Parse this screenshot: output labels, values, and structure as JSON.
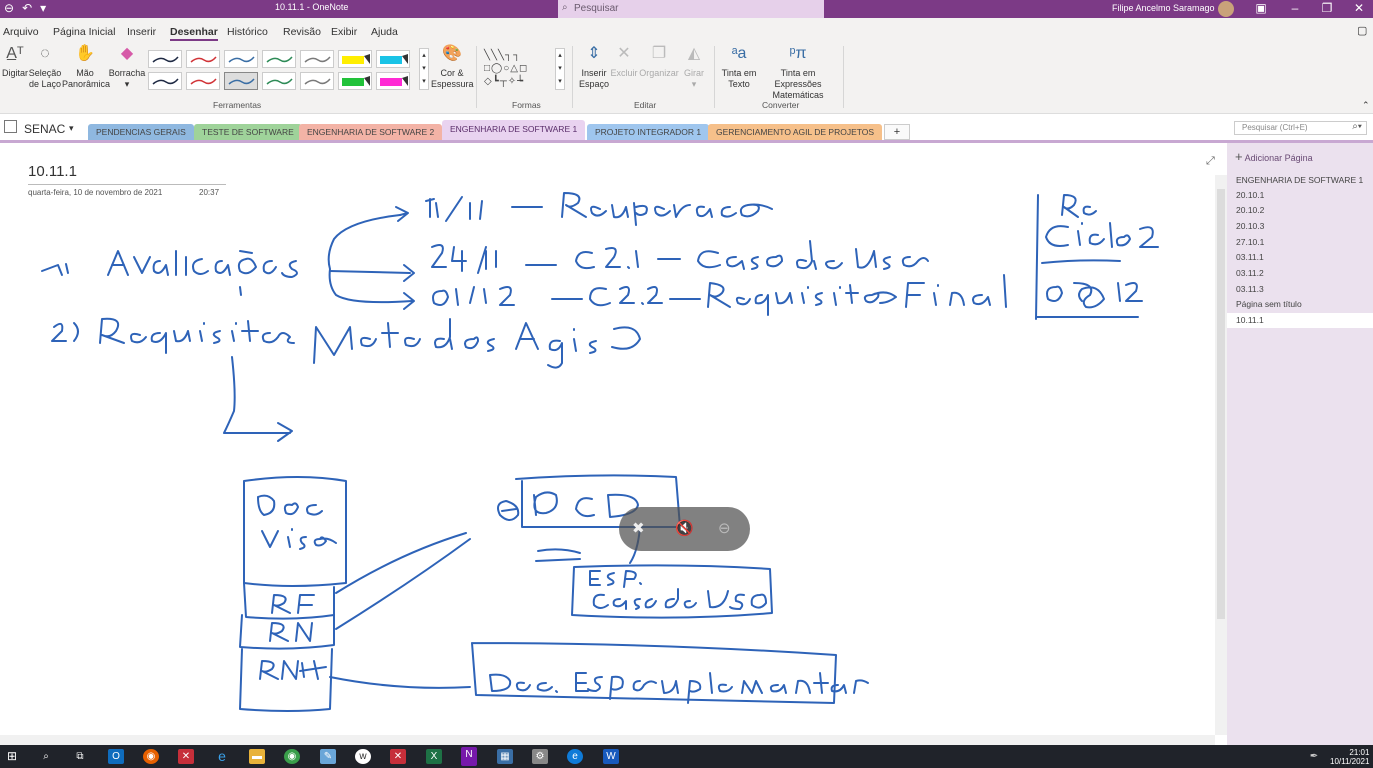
{
  "titlebar": {
    "title": "10.11.1 - OneNote",
    "search_placeholder": "Pesquisar",
    "user": "Filipe Ancelmo Saramago"
  },
  "menu": [
    "Arquivo",
    "Página Inicial",
    "Inserir",
    "Desenhar",
    "Histórico",
    "Revisão",
    "Exibir",
    "Ajuda"
  ],
  "menu_active": "Desenhar",
  "ribbon": {
    "tools": [
      "Digitar",
      "Seleção de Laço",
      "Mão Panorâmica",
      "Borracha"
    ],
    "color_thickness": "Cor & Espessura",
    "shapes_label": "Formas",
    "insert_space": "Inserir Espaço",
    "delete": "Excluir",
    "arrange": "Organizar",
    "rotate": "Girar",
    "ink_to_text": "Tinta em Texto",
    "ink_to_math": "Tinta em Expressões Matemáticas",
    "groups": {
      "tools": "Ferramentas",
      "shapes": "Formas",
      "edit": "Editar",
      "convert": "Converter"
    },
    "pen_colors": [
      "#1f2a44",
      "#d13438",
      "#3a6ea5",
      "#2e8b57",
      "#7a7a7a",
      "#ffee00",
      "#19c3e6",
      "#1f2a44",
      "#d13438",
      "#3a6ea5",
      "#2e8b57",
      "#7a7a7a",
      "#22c23a",
      "#ff2ad4"
    ]
  },
  "notebook": "SENAC",
  "tabs": [
    {
      "label": "PENDENCIAS GERAIS",
      "color": "#8fb8e0"
    },
    {
      "label": "TESTE DE SOFTWARE",
      "color": "#9fd39a"
    },
    {
      "label": "ENGENHARIA DE SOFTWARE 2",
      "color": "#f3b3a6"
    },
    {
      "label": "ENGENHARIA DE SOFTWARE 1",
      "color": "#e9d3f0"
    },
    {
      "label": "PROJETO INTEGRADOR 1",
      "color": "#9fc6ee"
    },
    {
      "label": "GERENCIAMENTO AGIL DE PROJETOS",
      "color": "#f6c08a"
    }
  ],
  "add_tab": "+",
  "page_search_placeholder": "Pesquisar (Ctrl+E)",
  "page": {
    "title": "10.11.1",
    "date": "quarta-feira, 10 de novembro de 2021",
    "time": "20:37"
  },
  "sidebar": {
    "add_page": "Adicionar Página",
    "section": "ENGENHARIA DE SOFTWARE 1",
    "pages": [
      "20.10.1",
      "20.10.2",
      "20.10.3",
      "27.10.1",
      "03.11.1",
      "03.11.2",
      "03.11.3",
      "Página sem título",
      "10.11.1"
    ],
    "current": "10.11.1"
  },
  "ink": {
    "color": "#2e63b8"
  },
  "taskbar": {
    "time": "21:01",
    "date": "10/11/2021"
  }
}
